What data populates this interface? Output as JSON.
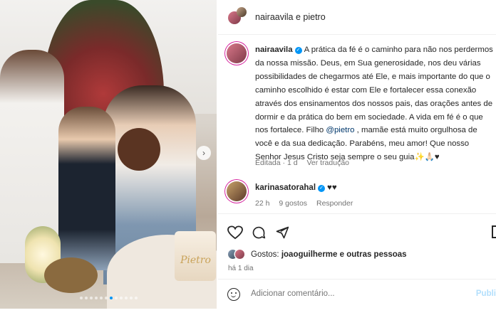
{
  "header": {
    "account_line": "nairaavila e pietro"
  },
  "caption": {
    "username": "nairaavila",
    "text_1": "A prática da fé é o caminho para não nos perdermos da nossa missão. Deus, em Sua generosidade, nos deu várias possibilidades de chegarmos até Ele, e mais importante do que o caminho escolhido é estar com Ele e fortalecer essa conexão através dos ensinamentos dos nossos pais, das orações antes de dormir e da prática do bem em sociedade. A vida em fé é o que nos fortalece. Filho ",
    "mention": "@pietro",
    "text_2": " , mamãe está muito orgulhosa de você e da sua dedicação. Parabéns, meu amor! Que nosso Senhor Jesus Cristo seja sempre o seu guia",
    "emoji": "✨🙏🏻♥",
    "edited": "Editada · 1 d",
    "see_translation": "Ver tradução"
  },
  "comment": {
    "username": "karinasatorahal",
    "text": "♥♥",
    "time": "22 h",
    "likes": "9 gostos",
    "reply": "Responder"
  },
  "likes_line": {
    "prefix": "Gostos: ",
    "names": "joaoguilherme e outras pessoas"
  },
  "date": "há 1 dia",
  "composer": {
    "placeholder": "Adicionar comentário...",
    "post_label": "Publi"
  },
  "photo": {
    "cake_text": "Pietro",
    "carousel_dots": 12,
    "active_dot": 6
  },
  "colors": {
    "accent": "#0095f6",
    "mention": "#00376b",
    "muted": "#737373"
  }
}
